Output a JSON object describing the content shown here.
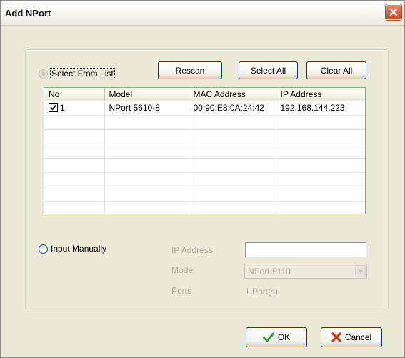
{
  "window": {
    "title": "Add NPort"
  },
  "select_from_list": {
    "label": "Select From List",
    "rescan": "Rescan",
    "select_all": "Select All",
    "clear_all": "Clear All"
  },
  "table": {
    "columns": [
      "No",
      "Model",
      "MAC Address",
      "IP Address"
    ],
    "rows": [
      {
        "checked": true,
        "no": "1",
        "model": "NPort 5610-8",
        "mac": "00:90:E8:0A:24:42",
        "ip": "192.168.144.223"
      }
    ]
  },
  "input_manually": {
    "label": "Input Manually",
    "ip_label": "IP Address",
    "ip_value": "",
    "model_label": "Model",
    "model_value": "NPort 5110",
    "ports_label": "Ports",
    "ports_value": "1 Port(s)"
  },
  "footer": {
    "ok": "OK",
    "cancel": "Cancel"
  },
  "colors": {
    "window_bg": "#ece9d8",
    "ok_icon": "#2e9b2e",
    "cancel_icon": "#c8361b"
  }
}
